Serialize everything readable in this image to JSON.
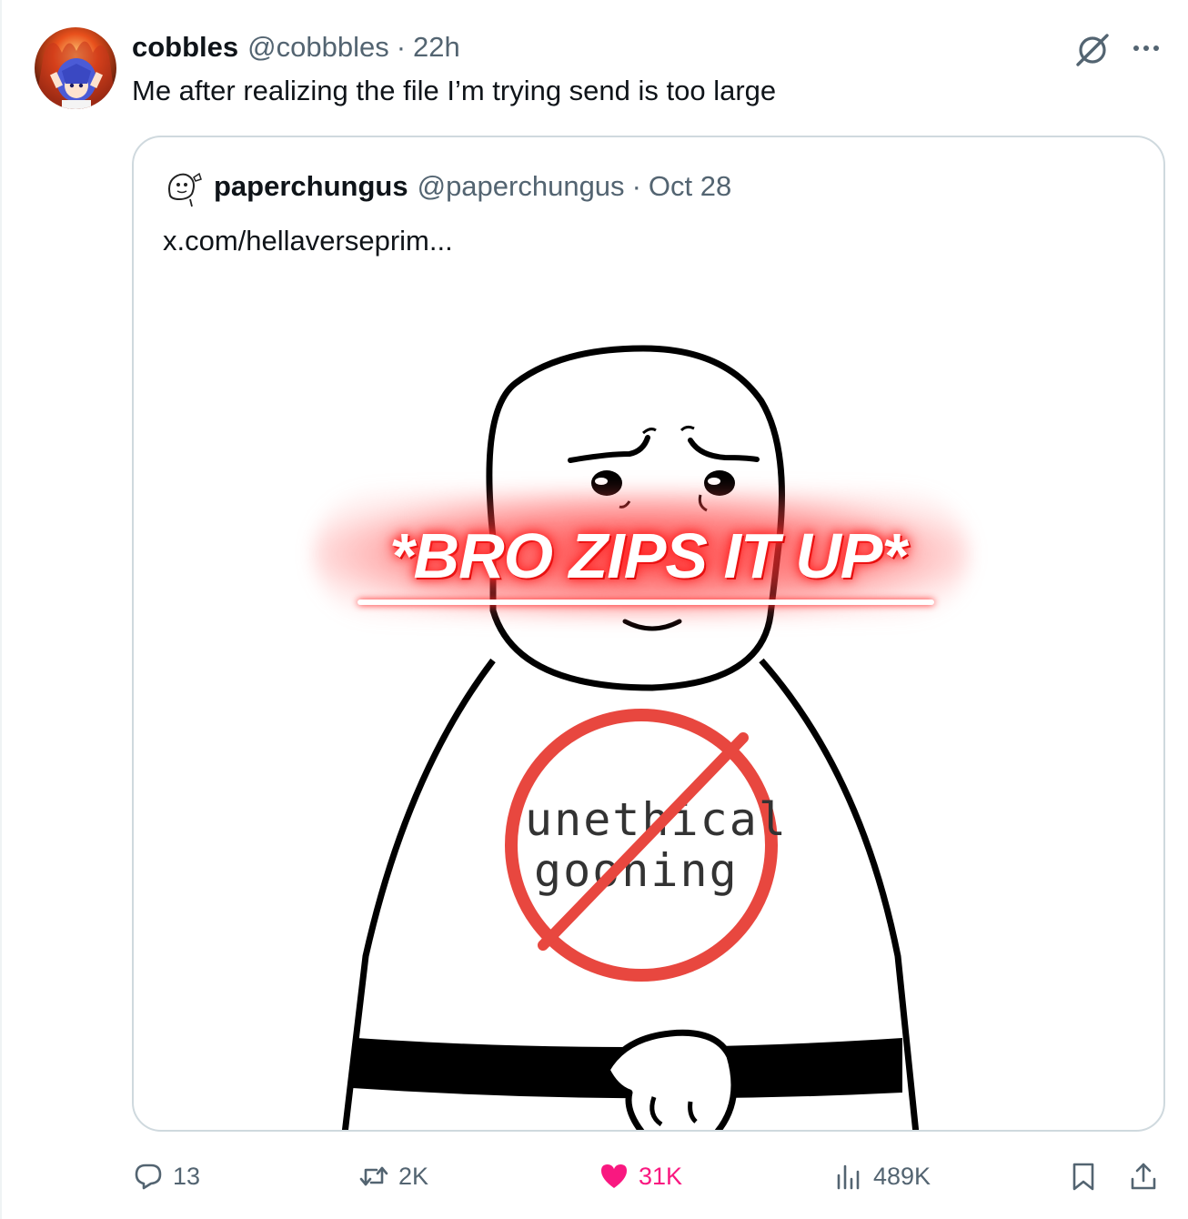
{
  "tweet": {
    "display_name": "cobbles",
    "handle": "@cobbbles",
    "separator": "·",
    "time": "22h",
    "text": "Me after realizing the file I’m trying send is too large"
  },
  "quoted_tweet": {
    "display_name": "paperchungus",
    "handle": "@paperchungus",
    "separator": "·",
    "date": "Oct 28",
    "text": "x.com/hellaverseprim..."
  },
  "meme": {
    "caption": "*BRO ZIPS IT UP*",
    "shirt_line1": "unethical",
    "shirt_line2": "gooning",
    "colors": {
      "glow": "#ff2a2a",
      "prohibition": "#e8473f",
      "ink": "#000000"
    }
  },
  "actions": {
    "replies": "13",
    "reposts": "2K",
    "likes": "31K",
    "views": "489K"
  },
  "icons": [
    "grok-icon",
    "more-icon",
    "reply-icon",
    "repost-icon",
    "like-icon",
    "views-icon",
    "bookmark-icon",
    "share-icon"
  ],
  "colors": {
    "text": "#0f1419",
    "muted": "#536471",
    "border": "#cfd9de",
    "like": "#f91880"
  }
}
